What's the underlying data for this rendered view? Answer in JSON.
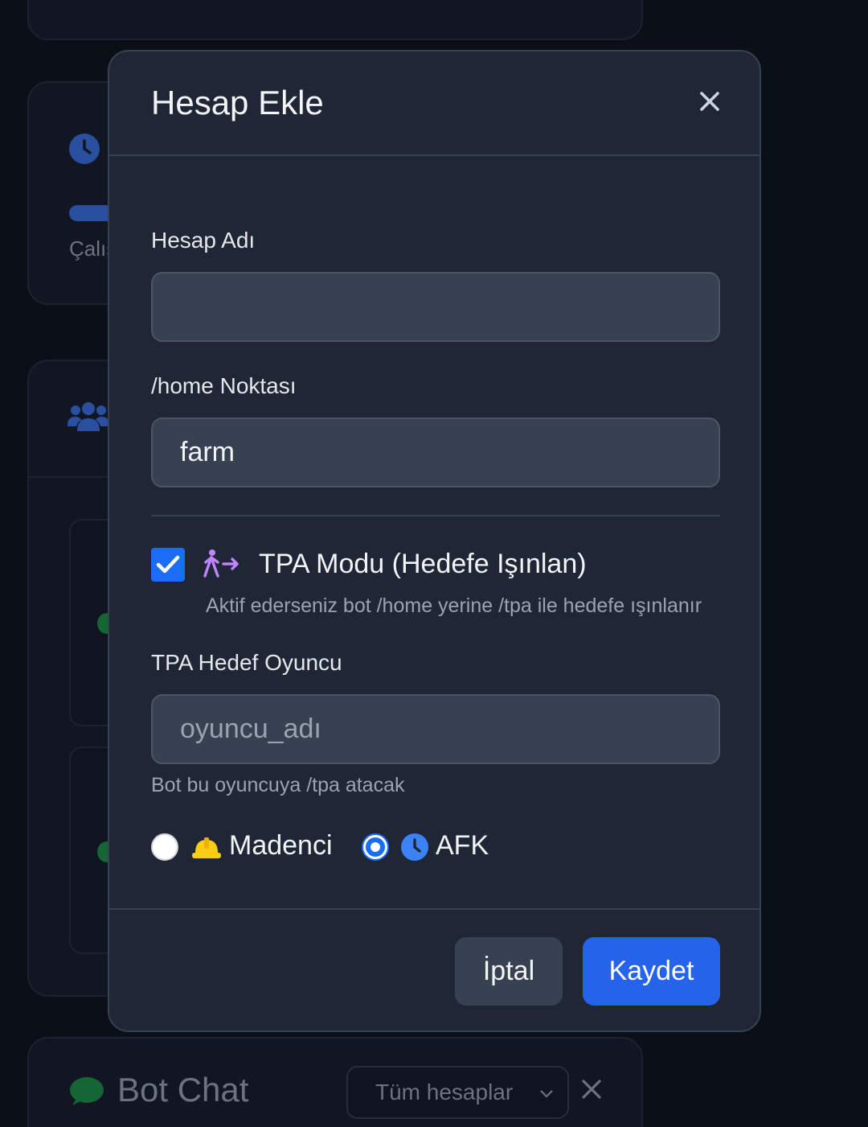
{
  "background": {
    "status_text": "Çalış",
    "chat": {
      "title": "Bot Chat",
      "account_filter": "Tüm hesaplar"
    }
  },
  "modal": {
    "title": "Hesap Ekle",
    "account_name": {
      "label": "Hesap Adı",
      "value": "",
      "placeholder": ""
    },
    "home_point": {
      "label": "/home Noktası",
      "value": "farm"
    },
    "tpa_mode": {
      "label": "TPA Modu (Hedefe Işınlan)",
      "checked": true,
      "help": "Aktif ederseniz bot /home yerine /tpa ile hedefe ışınlanır"
    },
    "tpa_target": {
      "label": "TPA Hedef Oyuncu",
      "value": "",
      "placeholder": "oyuncu_adı",
      "hint": "Bot bu oyuncuya /tpa atacak"
    },
    "mode_options": [
      {
        "label": "Madenci",
        "icon": "hard-hat-icon",
        "selected": false
      },
      {
        "label": "AFK",
        "icon": "clock-icon",
        "selected": true
      }
    ],
    "buttons": {
      "cancel": "İptal",
      "save": "Kaydet"
    }
  },
  "colors": {
    "accent": "#2563eb",
    "checkbox": "#1a6ef5",
    "modal_bg": "#1f2737",
    "input_bg": "#374151",
    "tpa_icon": "#c084fc",
    "hard_hat": "#facc15"
  }
}
